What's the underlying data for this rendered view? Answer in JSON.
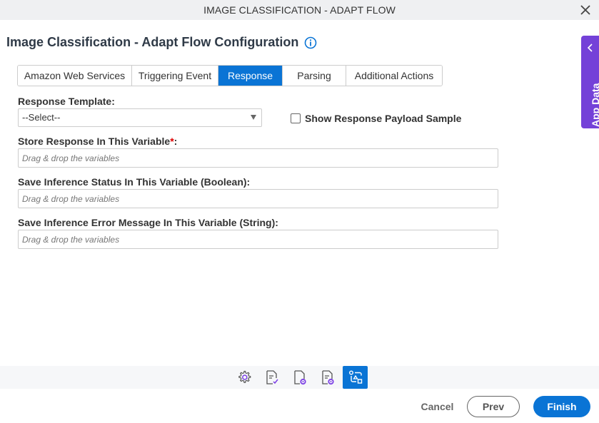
{
  "window": {
    "title": "IMAGE CLASSIFICATION - ADAPT FLOW"
  },
  "header": {
    "title": "Image Classification - Adapt Flow Configuration"
  },
  "tabs": [
    {
      "label": "Amazon Web Services",
      "active": false
    },
    {
      "label": "Triggering Event",
      "active": false
    },
    {
      "label": "Response",
      "active": true
    },
    {
      "label": "Parsing",
      "active": false
    },
    {
      "label": "Additional Actions",
      "active": false
    }
  ],
  "form": {
    "response_template": {
      "label": "Response Template:",
      "value": "--Select--"
    },
    "show_payload": {
      "label": "Show Response Payload Sample",
      "checked": false
    },
    "store_response": {
      "label": "Store Response In This Variable",
      "required_mark": "*",
      "suffix": ":",
      "placeholder": "Drag & drop the variables"
    },
    "inference_status": {
      "label": "Save Inference Status In This Variable (Boolean):",
      "placeholder": "Drag & drop the variables"
    },
    "inference_error": {
      "label": "Save Inference Error Message In This Variable (String):",
      "placeholder": "Drag & drop the variables"
    }
  },
  "side_panel": {
    "label": "App Data"
  },
  "toolbar": {
    "icons": [
      "gear-icon",
      "document-check-icon",
      "document-settings-icon",
      "document-list-settings-icon",
      "flow-diagram-icon"
    ],
    "active_index": 4
  },
  "footer": {
    "cancel": "Cancel",
    "prev": "Prev",
    "finish": "Finish"
  },
  "colors": {
    "accent": "#0a74d5",
    "side_panel": "#7441d8",
    "icon_accent": "#7b3fe4"
  }
}
